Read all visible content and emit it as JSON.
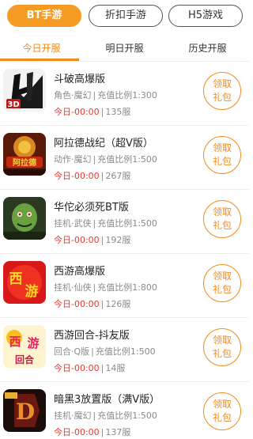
{
  "top_tabs": [
    {
      "label": "BT手游",
      "active": true
    },
    {
      "label": "折扣手游",
      "active": false
    },
    {
      "label": "H5游戏",
      "active": false
    }
  ],
  "sub_tabs": [
    {
      "label": "今日开服",
      "active": true
    },
    {
      "label": "明日开服",
      "active": false
    },
    {
      "label": "历史开服",
      "active": false
    }
  ],
  "claim_label": [
    "领取",
    "礼包"
  ],
  "games": [
    {
      "title": "斗破高爆版",
      "category": "角色",
      "theme": "魔幻",
      "meta_rest": "充值比例1:300",
      "time": "今日-00:00",
      "servers": "135服",
      "icon": "doupo-icon"
    },
    {
      "title": "阿拉德战纪（超V版）",
      "category": "动作",
      "theme": "魔幻",
      "meta_rest": "充值比例1:500",
      "time": "今日-00:00",
      "servers": "267服",
      "icon": "alade-icon"
    },
    {
      "title": "华佗必须死BT版",
      "category": "挂机",
      "theme": "武侠",
      "meta_rest": "充值比例1:500",
      "time": "今日-00:00",
      "servers": "192服",
      "icon": "huatuo-icon"
    },
    {
      "title": "西游高爆版",
      "category": "挂机",
      "theme": "仙侠",
      "meta_rest": "充值比例1:800",
      "time": "今日-00:00",
      "servers": "126服",
      "icon": "xiyou-icon"
    },
    {
      "title": "西游回合-抖友版",
      "category": "回合",
      "theme": "Q版",
      "meta_rest": "充值比例1:500",
      "time": "今日-00:00",
      "servers": "14服",
      "icon": "xiyou-huihe-icon"
    },
    {
      "title": "暗黑3放置版（满V版）",
      "category": "挂机",
      "theme": "魔幻",
      "meta_rest": "充值比例1:500",
      "time": "今日-00:00",
      "servers": "137服",
      "icon": "anhei-icon"
    }
  ],
  "colors": {
    "accent": "#f59a22",
    "time_red": "#e8382e",
    "meta_gray": "#8a8a8a"
  }
}
